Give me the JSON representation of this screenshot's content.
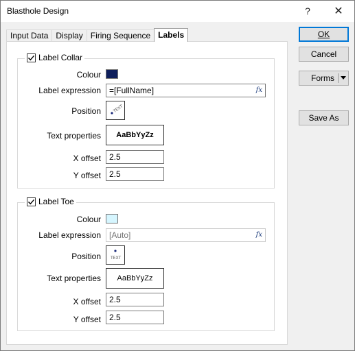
{
  "window": {
    "title": "Blasthole Design",
    "help_label": "?",
    "close_label": "✕"
  },
  "tabs": [
    {
      "label": "Input Data"
    },
    {
      "label": "Display"
    },
    {
      "label": "Firing Sequence"
    },
    {
      "label": "Labels"
    }
  ],
  "label_collar": {
    "checkbox_label": "Label Collar",
    "checked": true,
    "colour_label": "Colour",
    "colour": "#0f1f5c",
    "expression_label": "Label expression",
    "expression_value": "=[FullName]",
    "position_label": "Position",
    "position_text": "TEXT",
    "text_properties_label": "Text properties",
    "text_properties_sample": "AaBbYyZz",
    "x_offset_label": "X offset",
    "x_offset_value": "2.5",
    "y_offset_label": "Y offset",
    "y_offset_value": "2.5"
  },
  "label_toe": {
    "checkbox_label": "Label Toe",
    "checked": true,
    "colour_label": "Colour",
    "colour": "#d6f6ff",
    "expression_label": "Label expression",
    "expression_placeholder": "[Auto]",
    "position_label": "Position",
    "position_text": "TEXT",
    "text_properties_label": "Text properties",
    "text_properties_sample": "AaBbYyZz",
    "x_offset_label": "X offset",
    "x_offset_value": "2.5",
    "y_offset_label": "Y offset",
    "y_offset_value": "2.5"
  },
  "buttons": {
    "ok_label": "OK",
    "cancel_label": "Cancel",
    "forms_label": "Forms",
    "save_as_label": "Save As"
  },
  "icons": {
    "fx": "fx-icon",
    "check": "checkmark-icon",
    "dropdown": "chevron-down-icon"
  }
}
